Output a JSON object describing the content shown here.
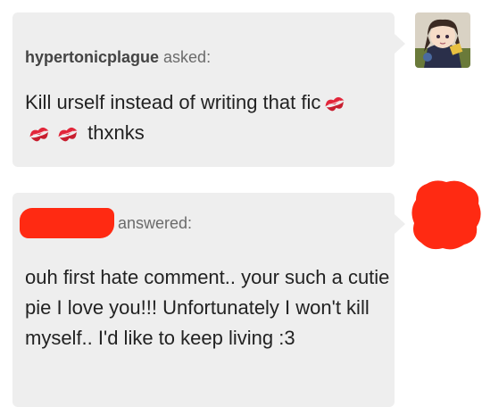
{
  "ask": {
    "asker_name": "hypertonicplague",
    "asked_word": " asked:",
    "line1": "Kill urself instead of writing that fic",
    "line2_text": "thxnks",
    "icons": [
      "kiss-mark-emoji",
      "kiss-mark-emoji",
      "kiss-mark-emoji"
    ]
  },
  "answer": {
    "answered_word": "answered:",
    "body": "ouh first hate comment.. your such a cutie pie I love you!!! Unfortunately I won't kill myself.. I'd like to keep living :3"
  },
  "colors": {
    "bubble": "#eeeeee",
    "redaction": "#ff2a12",
    "text": "#222222",
    "meta_text": "#6b6b6b"
  }
}
